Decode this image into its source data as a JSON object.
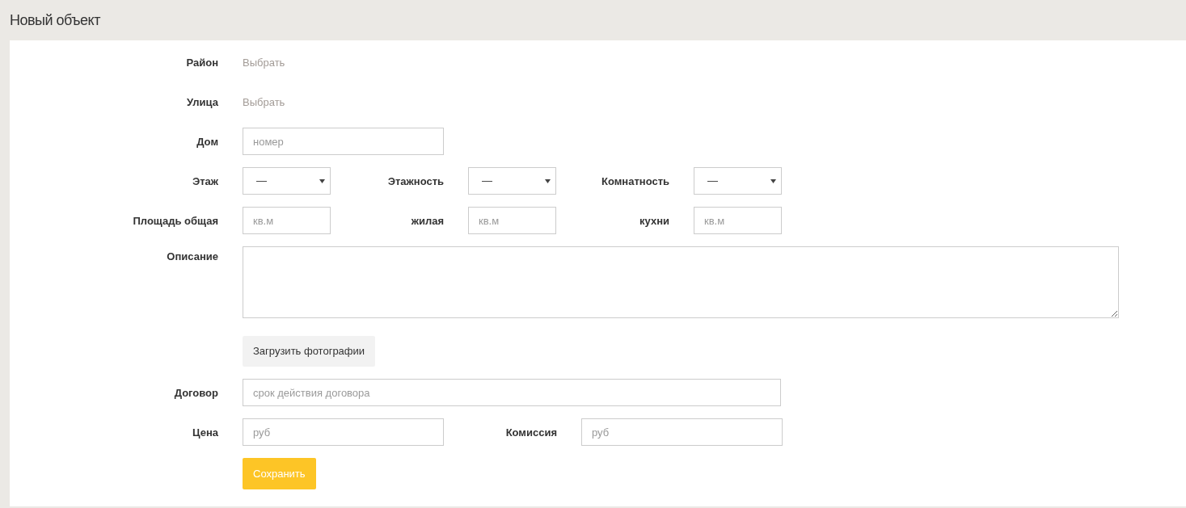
{
  "title": "Новый объект",
  "rows": [
    {
      "items": [
        {
          "kind": "picker",
          "label": "Район",
          "value": "Выбрать"
        }
      ]
    },
    {
      "items": [
        {
          "kind": "picker",
          "label": "Улица",
          "value": "Выбрать"
        }
      ]
    },
    {
      "items": [
        {
          "kind": "text",
          "label": "Дом",
          "placeholder": "номер"
        }
      ]
    },
    {
      "items": [
        {
          "kind": "select",
          "label": "Этаж",
          "value": "—"
        },
        {
          "kind": "select",
          "label": "Этажность",
          "value": "—"
        },
        {
          "kind": "select",
          "label": "Комнатность",
          "value": "—"
        }
      ]
    },
    {
      "items": [
        {
          "kind": "short",
          "label": "Площадь общая",
          "placeholder": "кв.м"
        },
        {
          "kind": "short",
          "label": "жилая",
          "placeholder": "кв.м"
        },
        {
          "kind": "short",
          "label": "кухни",
          "placeholder": "кв.м"
        }
      ]
    },
    {
      "items": [
        {
          "kind": "textarea",
          "label": "Описание"
        }
      ]
    },
    {
      "items": [
        {
          "kind": "upload",
          "text": "Загрузить фотографии"
        }
      ]
    },
    {
      "items": [
        {
          "kind": "long",
          "label": "Договор",
          "placeholder": "срок действия договора"
        }
      ]
    },
    {
      "items": [
        {
          "kind": "text",
          "label": "Цена",
          "placeholder": "руб"
        },
        {
          "kind": "text",
          "label": "Комиссия",
          "placeholder": "руб"
        }
      ]
    },
    {
      "items": [
        {
          "kind": "save",
          "text": "Сохранить"
        }
      ]
    }
  ]
}
